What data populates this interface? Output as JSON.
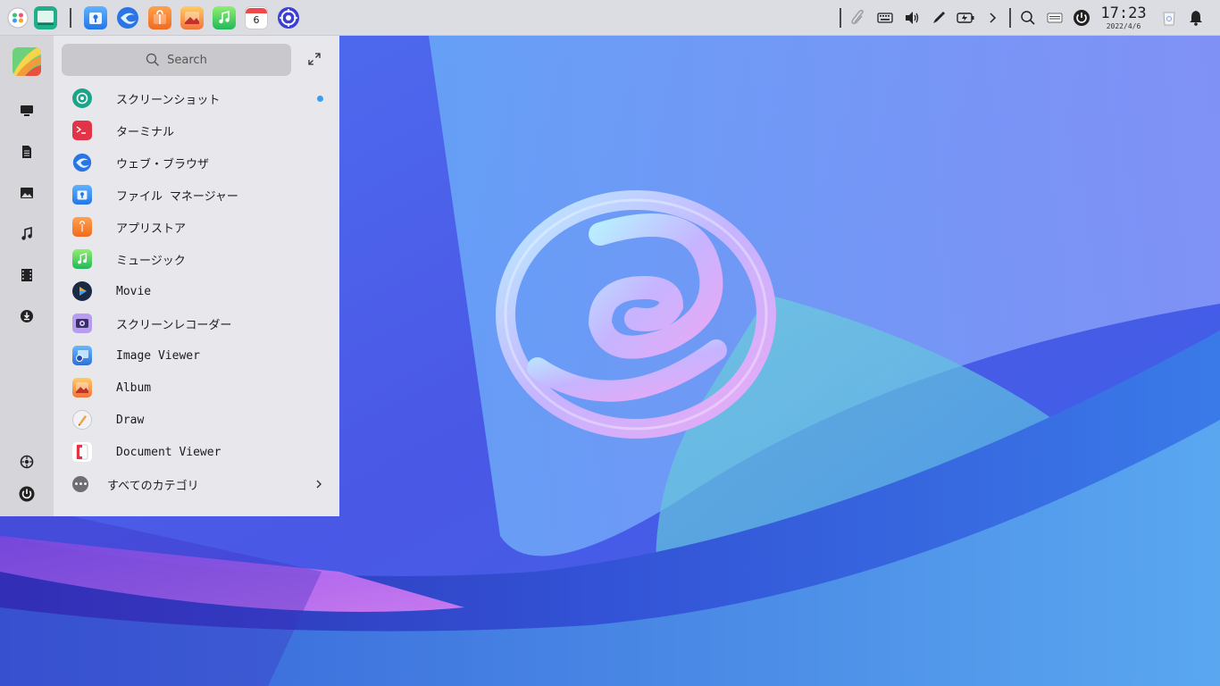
{
  "search": {
    "placeholder": "Search"
  },
  "clock": {
    "time": "17:23",
    "date": "2022/4/6"
  },
  "calendar_day": "6",
  "apps": [
    {
      "label": "スクリーンショット",
      "icon": "screenshot-icon",
      "new": true
    },
    {
      "label": "ターミナル",
      "icon": "terminal-icon"
    },
    {
      "label": "ウェブ・ブラウザ",
      "icon": "browser-icon"
    },
    {
      "label": "ファイル マネージャー",
      "icon": "file-manager-icon"
    },
    {
      "label": "アプリストア",
      "icon": "app-store-icon"
    },
    {
      "label": "ミュージック",
      "icon": "music-icon"
    },
    {
      "label": "Movie",
      "icon": "movie-icon"
    },
    {
      "label": "スクリーンレコーダー",
      "icon": "screen-recorder-icon"
    },
    {
      "label": "Image Viewer",
      "icon": "image-viewer-icon"
    },
    {
      "label": "Album",
      "icon": "album-icon"
    },
    {
      "label": "Draw",
      "icon": "draw-icon"
    },
    {
      "label": "Document Viewer",
      "icon": "document-viewer-icon"
    }
  ],
  "all_categories": {
    "label": "すべてのカテゴリ"
  },
  "colors": {
    "accent": "#3b9ef5",
    "panel": "#dcdde3",
    "menu": "#e8e8ec",
    "rail": "#d6d6da"
  }
}
